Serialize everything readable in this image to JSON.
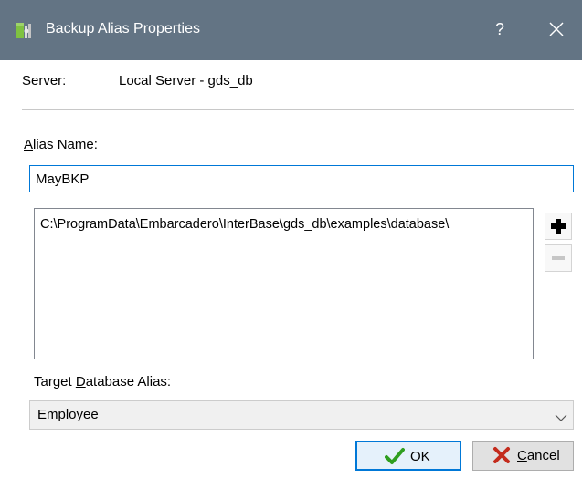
{
  "window": {
    "title": "Backup Alias Properties",
    "help_glyph": "?",
    "icon": "database-gear-icon"
  },
  "server": {
    "label": "Server:",
    "value": "Local Server - gds_db"
  },
  "alias": {
    "label_prefix": "",
    "label_mnemonic": "A",
    "label_rest": "lias Name:",
    "value": "MayBKP"
  },
  "backup_files": {
    "items": [
      "C:\\ProgramData\\Embarcadero\\InterBase\\gds_db\\examples\\database\\"
    ],
    "add_icon": "plus-icon",
    "remove_icon": "minus-icon"
  },
  "target": {
    "label_prefix": "Target ",
    "label_mnemonic": "D",
    "label_rest": "atabase Alias:",
    "value": "Employee"
  },
  "buttons": {
    "ok_mnemonic": "O",
    "ok_rest": "K",
    "cancel_mnemonic": "C",
    "cancel_rest": "ancel"
  },
  "colors": {
    "titlebar": "#637484",
    "accent": "#0078d7",
    "ok_check": "#2f9e1f",
    "cancel_x": "#c42b1c"
  }
}
